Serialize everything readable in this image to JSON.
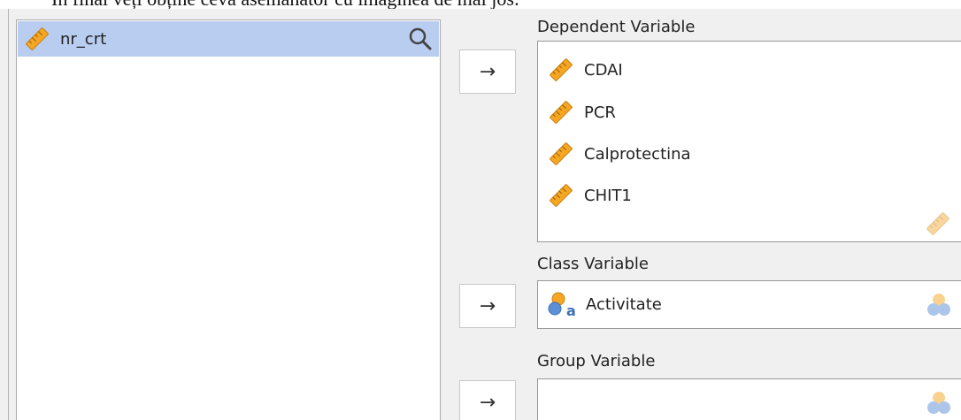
{
  "document_text": "În final veți obține ceva asemănător cu imaginea de mai jos:",
  "variables_list": {
    "items": [
      {
        "label": "nr_crt",
        "icon": "ruler-icon",
        "selected": true
      }
    ],
    "search_icon": "search-icon"
  },
  "move_button_label": "→",
  "dependent": {
    "title": "Dependent Variable",
    "items": [
      {
        "label": "CDAI",
        "icon": "ruler-icon"
      },
      {
        "label": "PCR",
        "icon": "ruler-icon"
      },
      {
        "label": "Calprotectina",
        "icon": "ruler-icon"
      },
      {
        "label": "CHIT1",
        "icon": "ruler-icon"
      }
    ],
    "accepts_icon": "ruler-icon"
  },
  "class_var": {
    "title": "Class Variable",
    "items": [
      {
        "label": "Activitate",
        "icon": "nominal-icon"
      }
    ],
    "accepts_icon": "nominal-icon"
  },
  "group_var": {
    "title": "Group Variable",
    "items": [],
    "accepts_icon": "nominal-icon"
  },
  "colors": {
    "selection": "#b8cdef",
    "ruler": "#f5a623",
    "nominal_orange": "#f5a623",
    "nominal_blue": "#5b8fd6"
  }
}
